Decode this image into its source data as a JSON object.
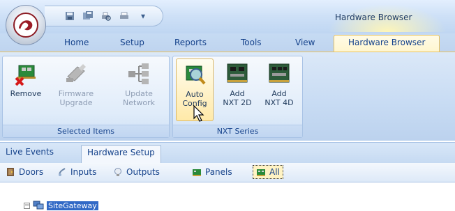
{
  "app": {
    "title": "Hardware Browser"
  },
  "quick_access": [
    {
      "icon": "save-icon"
    },
    {
      "icon": "save-all-icon"
    },
    {
      "icon": "print-preview-icon"
    },
    {
      "icon": "print-icon"
    }
  ],
  "ribbon_tabs": [
    {
      "label": "Home"
    },
    {
      "label": "Setup"
    },
    {
      "label": "Reports"
    },
    {
      "label": "Tools"
    },
    {
      "label": "View"
    },
    {
      "label": "Hardware Browser",
      "active": true
    }
  ],
  "groups": {
    "selected_items": {
      "label": "Selected Items",
      "buttons": [
        {
          "label": "Remove",
          "icon": "remove-board-icon",
          "enabled": true
        },
        {
          "label": "Firmware\nUpgrade",
          "icon": "firmware-upgrade-icon",
          "enabled": false
        },
        {
          "label": "Update\nNetwork",
          "icon": "update-network-icon",
          "enabled": false
        }
      ]
    },
    "nxt_series": {
      "label": "NXT Series",
      "buttons": [
        {
          "label": "Auto\nConfig",
          "icon": "auto-config-icon",
          "enabled": true,
          "hover": true
        },
        {
          "label": "Add\nNXT 2D",
          "icon": "nxt-2d-board-icon",
          "enabled": true
        },
        {
          "label": "Add\nNXT 4D",
          "icon": "nxt-4d-board-icon",
          "enabled": true
        }
      ]
    }
  },
  "document_tabs": [
    {
      "label": "Live Events"
    },
    {
      "label": "Hardware Setup",
      "active": true
    }
  ],
  "filters": [
    {
      "label": "Doors",
      "icon": "door-icon"
    },
    {
      "label": "Inputs",
      "icon": "input-icon"
    },
    {
      "label": "Outputs",
      "icon": "output-icon"
    },
    {
      "label": "Panels",
      "icon": "panel-icon"
    },
    {
      "label": "All",
      "icon": "all-icon",
      "active": true
    }
  ],
  "tree": {
    "root": {
      "label": "SiteGateway",
      "expander": "−",
      "selected": true
    }
  },
  "colors": {
    "accent": "#15428b",
    "tab_highlight": "#fff6cf",
    "selection": "#3169c6"
  }
}
